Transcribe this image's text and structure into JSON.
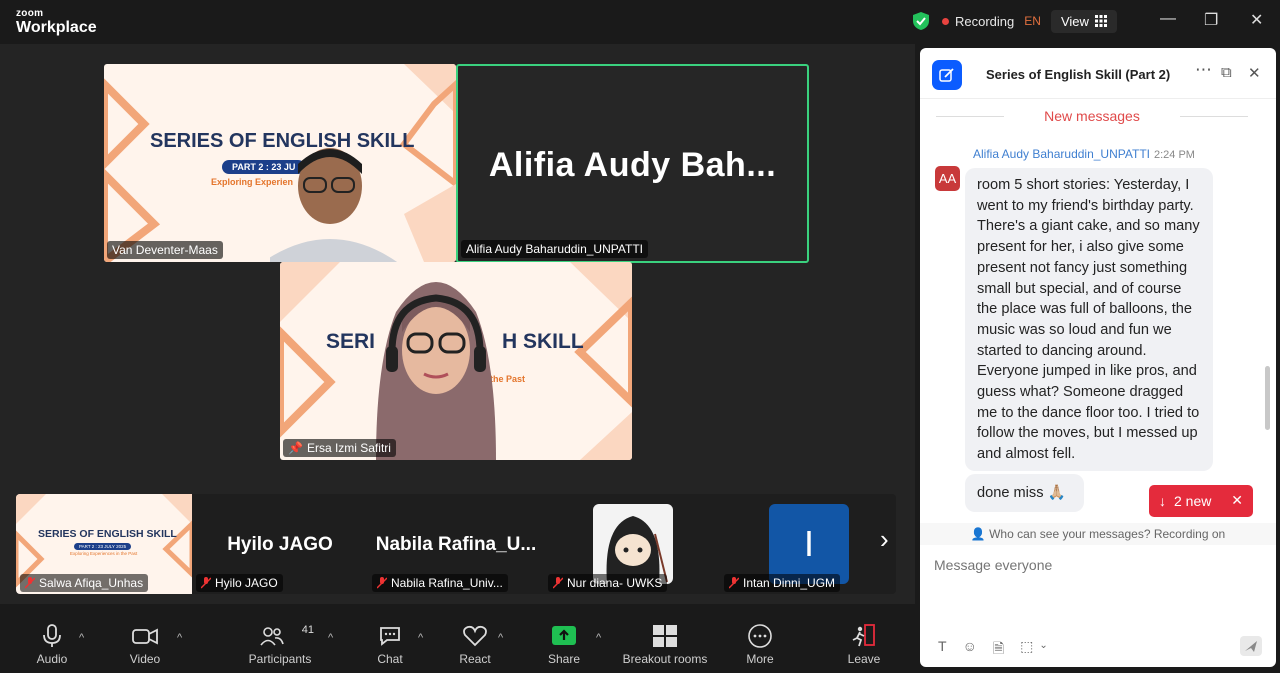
{
  "app": {
    "brand_top": "zoom",
    "brand_bottom": "Workplace"
  },
  "titlebar": {
    "recording": "Recording",
    "lang": "EN",
    "view": "View"
  },
  "tiles": {
    "van": {
      "name": "Van Deventer-Maas",
      "slide_title": "SERIES OF ENGLISH SKILL",
      "slide_part": "PART 2 : 23 JU",
      "slide_sub": "Exploring Experien"
    },
    "alifia": {
      "display": "Alifia  Audy  Bah...",
      "name": "Alifia Audy Baharuddin_UNPATTI"
    },
    "ersa": {
      "name": "Ersa Izmi Safitri",
      "slide_left": "SERI",
      "slide_right": "H SKILL",
      "slide_sub": "the Past"
    }
  },
  "strip": [
    {
      "name": "Salwa Afiqa_Unhas",
      "display": "",
      "slide_title": "SERIES OF ENGLISH SKILL",
      "slide_part": "PART 2 : 23 JULY 2025",
      "slide_sub": "Exploring Experiences in the Past"
    },
    {
      "name": "Hyilo JAGO",
      "display": "Hyilo JAGO"
    },
    {
      "name": "Nabila Rafina_Univ...",
      "display": "Nabila  Rafina_U..."
    },
    {
      "name": "Nur diana- UWKS",
      "display": ""
    },
    {
      "name": "Intan Dinni_UGM",
      "display": "I"
    }
  ],
  "toolbar": {
    "audio": "Audio",
    "video": "Video",
    "participants": "Participants",
    "participants_count": "41",
    "chat": "Chat",
    "react": "React",
    "share": "Share",
    "breakout": "Breakout rooms",
    "more": "More",
    "leave": "Leave"
  },
  "chat": {
    "title": "Series of English Skill (Part 2)",
    "new_messages": "New messages",
    "sender": "Alifia Audy Baharuddin_UNPATTI",
    "time": "2:24 PM",
    "avatar": "AA",
    "message1": "room 5 short stories: Yesterday, I went to my friend's birthday party. There's a giant cake, and so many present for her, i also give some present not fancy just something small but special, and of course the place was full of balloons, the music was so loud and fun we started to dancing around. Everyone jumped in like pros, and guess what? Someone dragged me to the dance floor too. I tried to follow the moves, but I messed up and almost fell.",
    "message2": "done miss 🙏🏼",
    "new_pill": "2 new",
    "who_can_see": "Who can see your messages? Recording on",
    "input_placeholder": "Message everyone"
  },
  "colors": {
    "accent": "#0b5cff",
    "active_speaker": "#3ad17e",
    "share": "#1fbf52",
    "alert": "#e42b3c"
  }
}
